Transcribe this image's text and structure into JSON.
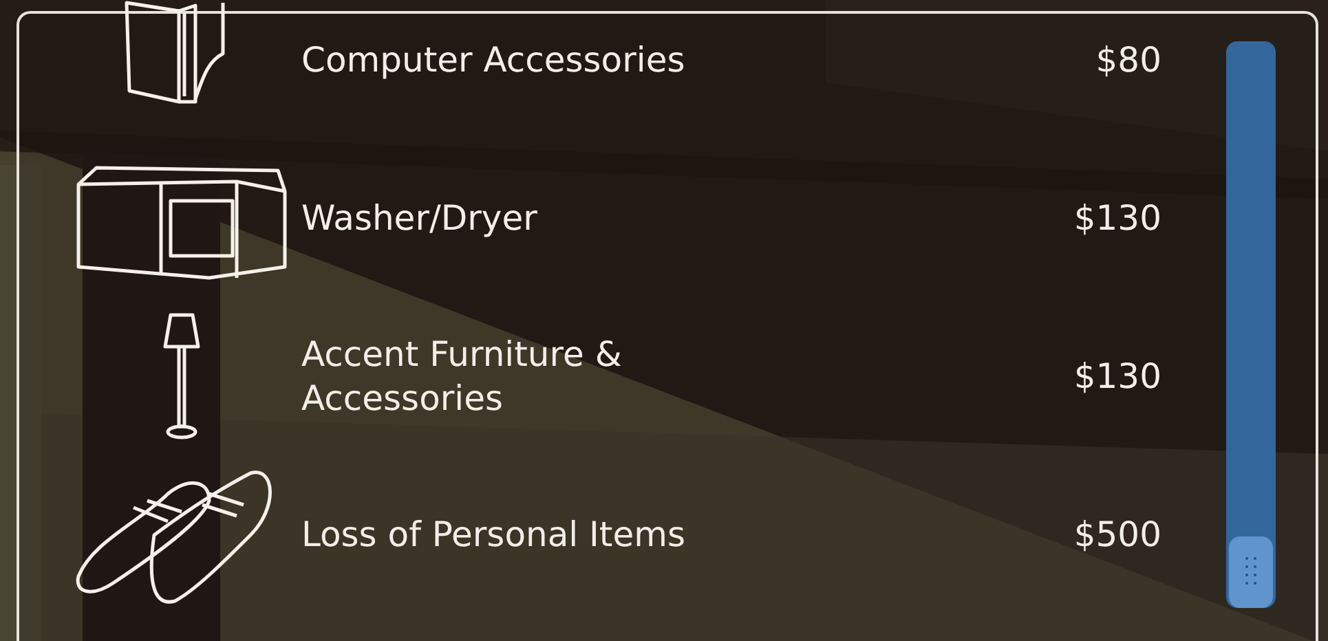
{
  "items": [
    {
      "kind": "computer",
      "label": "Computer Accessories",
      "price": "$80"
    },
    {
      "kind": "washer",
      "label": "Washer/Dryer",
      "price": "$130"
    },
    {
      "kind": "lamp",
      "label": "Accent Furniture & Accessories",
      "price": "$130"
    },
    {
      "kind": "shoes",
      "label": "Loss of Personal Items",
      "price": "$500"
    }
  ]
}
